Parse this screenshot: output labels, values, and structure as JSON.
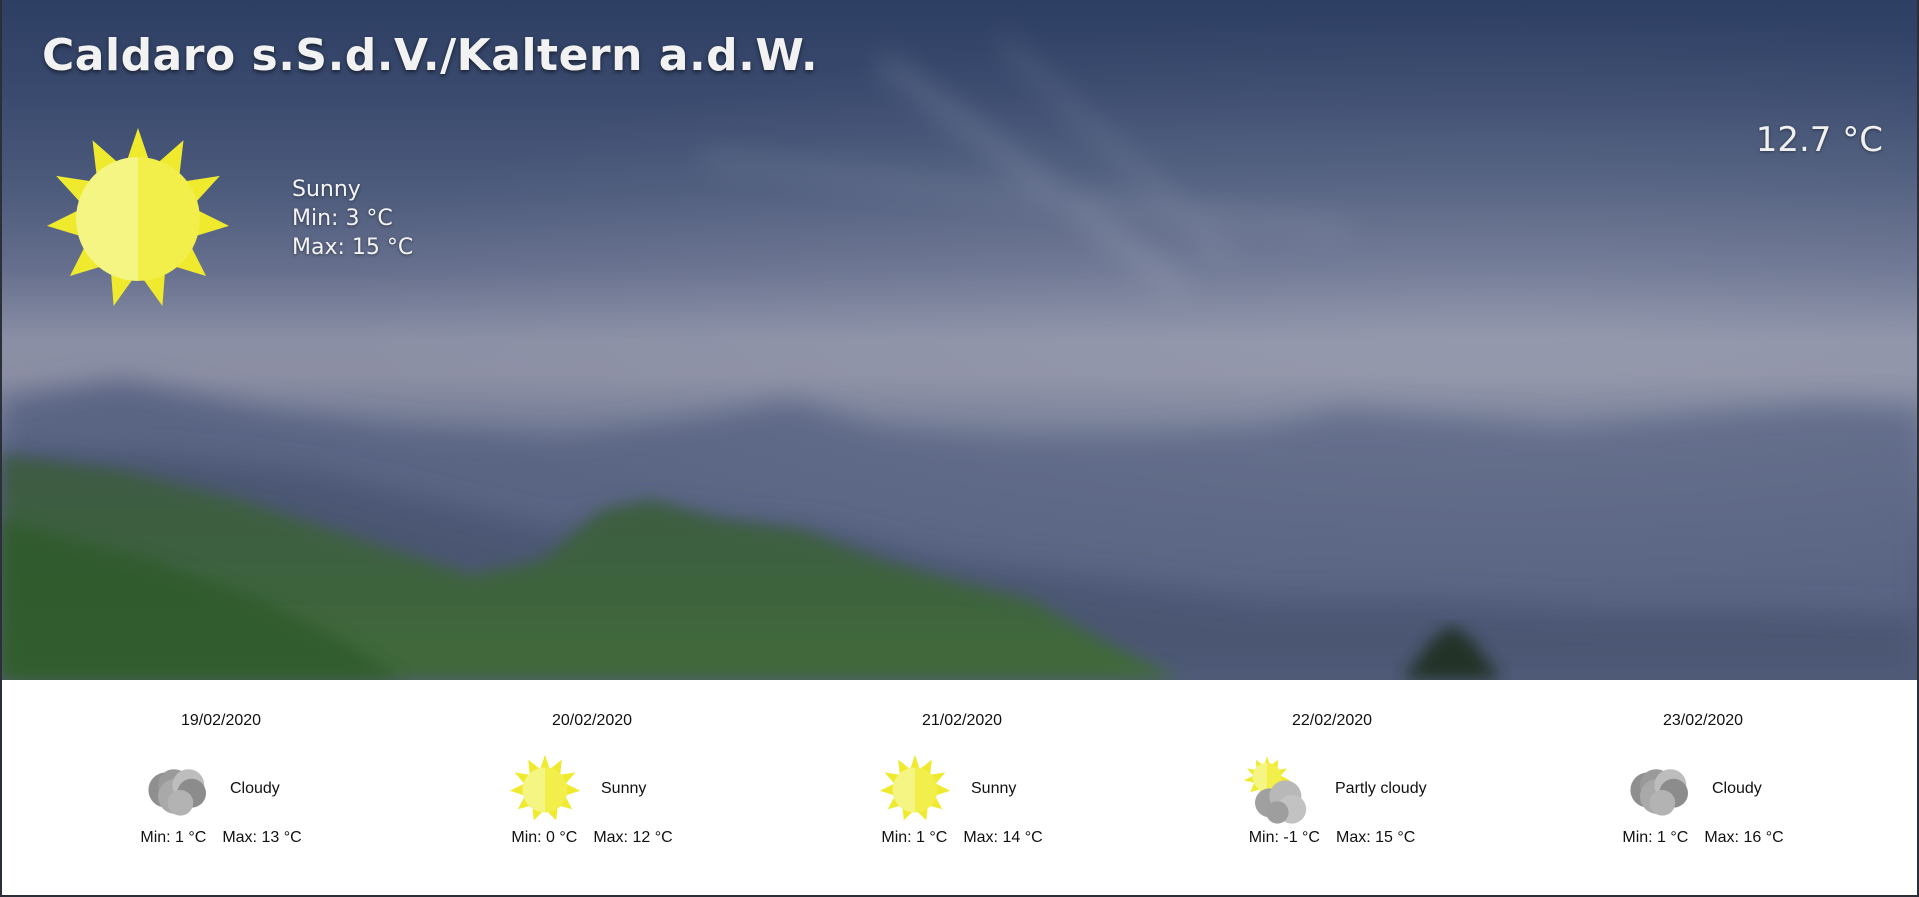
{
  "location": {
    "name": "Caldaro s.S.d.V./Kaltern a.d.W."
  },
  "current": {
    "temperature": "12.7 °C",
    "condition": "Sunny",
    "min": "Min: 3 °C",
    "max": "Max: 15 °C",
    "icon": "sun-icon"
  },
  "forecast": [
    {
      "date": "19/02/2020",
      "condition": "Cloudy",
      "min": "Min: 1 °C",
      "max": "Max: 13 °C",
      "icon": "cloudy-icon"
    },
    {
      "date": "20/02/2020",
      "condition": "Sunny",
      "min": "Min: 0 °C",
      "max": "Max: 12 °C",
      "icon": "sun-icon"
    },
    {
      "date": "21/02/2020",
      "condition": "Sunny",
      "min": "Min: 1 °C",
      "max": "Max: 14 °C",
      "icon": "sun-icon"
    },
    {
      "date": "22/02/2020",
      "condition": "Partly cloudy",
      "min": "Min: -1 °C",
      "max": "Max: 15 °C",
      "icon": "partly-cloudy-icon"
    },
    {
      "date": "23/02/2020",
      "condition": "Cloudy",
      "min": "Min: 1 °C",
      "max": "Max: 16 °C",
      "icon": "cloudy-icon"
    }
  ],
  "colors": {
    "sun_light": "#f5f57a",
    "sun_main": "#f2ee4a",
    "sun_ray": "#f0ea2e",
    "cloud_dark": "#8f8f8f",
    "cloud_mid": "#a5a5a5",
    "cloud_light": "#bdbdbd"
  }
}
